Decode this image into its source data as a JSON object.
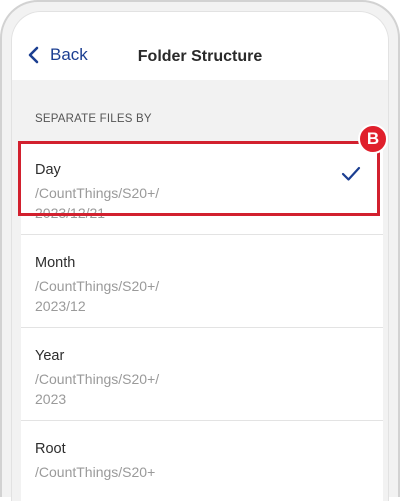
{
  "header": {
    "back_label": "Back",
    "title": "Folder Structure"
  },
  "section": {
    "label": "SEPARATE FILES BY"
  },
  "options": [
    {
      "name": "Day",
      "path_line1": "/CountThings/S20+/",
      "path_line2": "2023/12/21",
      "selected": true
    },
    {
      "name": "Month",
      "path_line1": "/CountThings/S20+/",
      "path_line2": "2023/12",
      "selected": false
    },
    {
      "name": "Year",
      "path_line1": "/CountThings/S20+/",
      "path_line2": "2023",
      "selected": false
    },
    {
      "name": "Root",
      "path_line1": "/CountThings/S20+",
      "path_line2": "",
      "selected": false
    }
  ],
  "annotation": {
    "marker_label": "B"
  },
  "colors": {
    "accent": "#1b3e91",
    "highlight": "#d2202e",
    "background": "#f2f2f2"
  },
  "icons": {
    "back": "chevron-left-icon",
    "selected": "checkmark-icon"
  }
}
